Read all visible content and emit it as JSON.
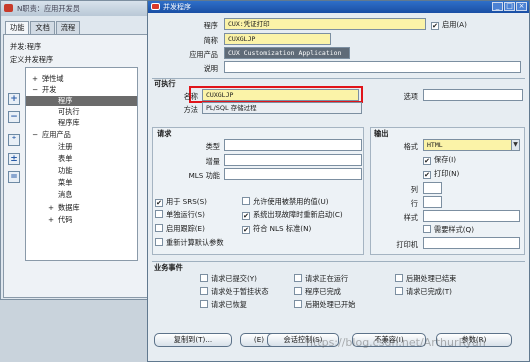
{
  "navigator": {
    "title": "N职责：应用开发员",
    "tabs": [
      "功能",
      "文档",
      "流程"
    ],
    "heading1": "并发:程序",
    "heading2": "定义并发程序",
    "tree": [
      "弹性域",
      "开发",
      "程序",
      "可执行",
      "程序库",
      "应用产品",
      "注册",
      "表单",
      "功能",
      "菜单",
      "消息",
      "数据库",
      "代码"
    ],
    "expanders": [
      "+",
      "−",
      "−",
      "+",
      "+"
    ]
  },
  "main": {
    "title": "并发程序",
    "program_label": "程序",
    "program_value": "CUX:凭证打印",
    "enabled_label": "启用(A)",
    "enabled_checked": true,
    "short_name_label": "简称",
    "short_name_value": "CUXGLJP",
    "application_label": "应用产品",
    "application_value": "CUX Customization Application",
    "description_label": "说明",
    "description_value": "",
    "executable_section": "可执行",
    "exe_name_label": "名称",
    "exe_name_value": "CUXGLJP",
    "exe_method_label": "方法",
    "exe_method_value": "PL/SQL 存储过程",
    "options_label": "选项",
    "options_value": "",
    "request_section": "请求",
    "type_label": "类型",
    "increment_label": "增量",
    "mls_label": "MLS 功能",
    "use_in_srs": "用于 SRS(S)",
    "allow_disabled": "允许使用被禁用的值(U)",
    "run_alone": "单独运行(S)",
    "restart_on_failure": "系统出现故障时重新启动(C)",
    "enable_trace": "启用跟踪(E)",
    "nls_compliant": "符合 NLS 标准(N)",
    "recalc_defaults": "重新计算默认参数",
    "output_section": "输出",
    "format_label": "格式",
    "format_value": "HTML",
    "save_label": "保存(I)",
    "print_label": "打印(N)",
    "columns_label": "列",
    "rows_label": "行",
    "style_label": "样式",
    "style_required_label": "需要样式(Q)",
    "printer_label": "打印机",
    "events_section": "业务事件",
    "events": [
      "请求已提交(Y)",
      "请求正在运行",
      "后期处理已结束",
      "请求处于暂挂状态",
      "程序已完成",
      "请求已完成(T)",
      "请求已恢复",
      "后期处理已开始"
    ],
    "buttons": {
      "copy": "复制到(T)...",
      "params": "(E)",
      "session": "会话控制(S)",
      "incompatible": "不兼容(I)",
      "parameters": "参数(R)"
    },
    "watermark": "https://blog.csdn.net/ArthurRyan"
  },
  "colors": {
    "required": "#fbf3a8",
    "highlight": "#e0141a",
    "titlebar": "#1a4fa4"
  }
}
